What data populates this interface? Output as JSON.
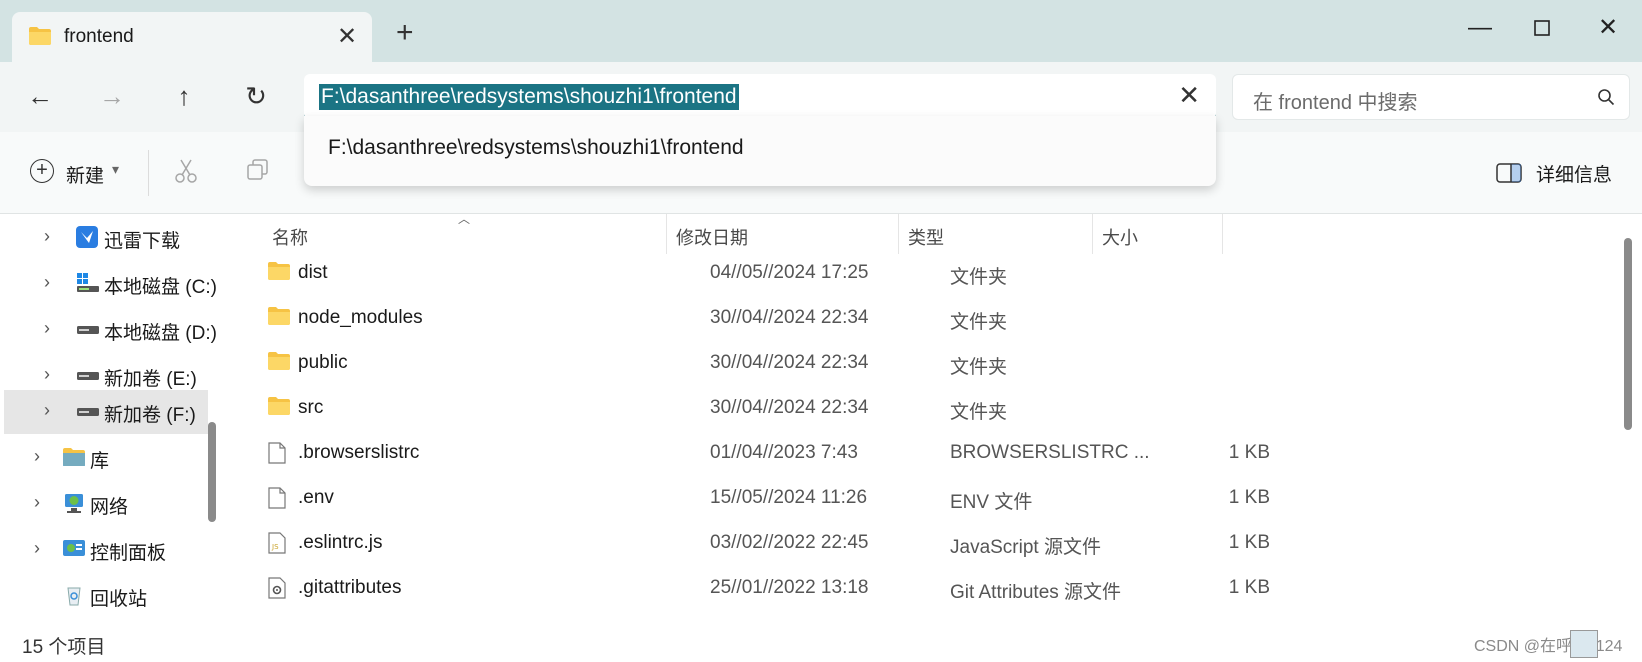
{
  "tab": {
    "title": "frontend"
  },
  "navigation": {
    "address": "F:\\dasanthree\\redsystems\\shouzhi1\\frontend",
    "search_placeholder": "在 frontend 中搜索"
  },
  "dropdown": {
    "suggestion": "F:\\dasanthree\\redsystems\\shouzhi1\\frontend"
  },
  "command_bar": {
    "new_label": "新建",
    "details_label": "详细信息"
  },
  "sidebar": {
    "items": [
      {
        "label": "迅雷下载",
        "icon": "xunlei-icon"
      },
      {
        "label": "本地磁盘 (C:)",
        "icon": "windows-drive-icon"
      },
      {
        "label": "本地磁盘 (D:)",
        "icon": "drive-icon"
      },
      {
        "label": "新加卷 (E:)",
        "icon": "drive-icon"
      },
      {
        "label": "新加卷 (F:)",
        "icon": "drive-icon",
        "selected": true
      },
      {
        "label": "库",
        "icon": "library-icon"
      },
      {
        "label": "网络",
        "icon": "network-icon"
      },
      {
        "label": "控制面板",
        "icon": "control-panel-icon"
      },
      {
        "label": "回收站",
        "icon": "recycle-bin-icon"
      }
    ]
  },
  "columns": {
    "name": "名称",
    "date": "修改日期",
    "type": "类型",
    "size": "大小"
  },
  "files": [
    {
      "name": "dist",
      "date": "04//05//2024 17:25",
      "type": "文件夹",
      "size": "",
      "icon": "folder-icon"
    },
    {
      "name": "node_modules",
      "date": "30//04//2024 22:34",
      "type": "文件夹",
      "size": "",
      "icon": "folder-icon"
    },
    {
      "name": "public",
      "date": "30//04//2024 22:34",
      "type": "文件夹",
      "size": "",
      "icon": "folder-icon"
    },
    {
      "name": "src",
      "date": "30//04//2024 22:34",
      "type": "文件夹",
      "size": "",
      "icon": "folder-icon"
    },
    {
      "name": ".browserslistrc",
      "date": "01//04//2023 7:43",
      "type": "BROWSERSLISTRC ...",
      "size": "1 KB",
      "icon": "file-icon"
    },
    {
      "name": ".env",
      "date": "15//05//2024 11:26",
      "type": "ENV 文件",
      "size": "1 KB",
      "icon": "file-icon"
    },
    {
      "name": ".eslintrc.js",
      "date": "03//02//2022 22:45",
      "type": "JavaScript 源文件",
      "size": "1 KB",
      "icon": "js-file-icon"
    },
    {
      "name": ".gitattributes",
      "date": "25//01//2022 13:18",
      "type": "Git Attributes 源文件",
      "size": "1 KB",
      "icon": "settings-file-icon"
    }
  ],
  "status": {
    "count_text": "15 个项目",
    "watermark": "CSDN @在呼吸1124"
  }
}
